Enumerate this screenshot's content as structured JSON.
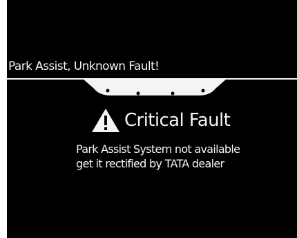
{
  "header": {
    "title": "Park Assist, Unknown Fault!"
  },
  "vehicle": {
    "icon": "rear-bumper-sensors-icon"
  },
  "fault": {
    "icon": "warning-triangle-icon",
    "title": "Critical Fault"
  },
  "message": {
    "lines": [
      "Park Assist System not available",
      "get it rectified by TATA dealer"
    ]
  },
  "colors": {
    "background": "#000000",
    "foreground": "#f4f4f4"
  }
}
